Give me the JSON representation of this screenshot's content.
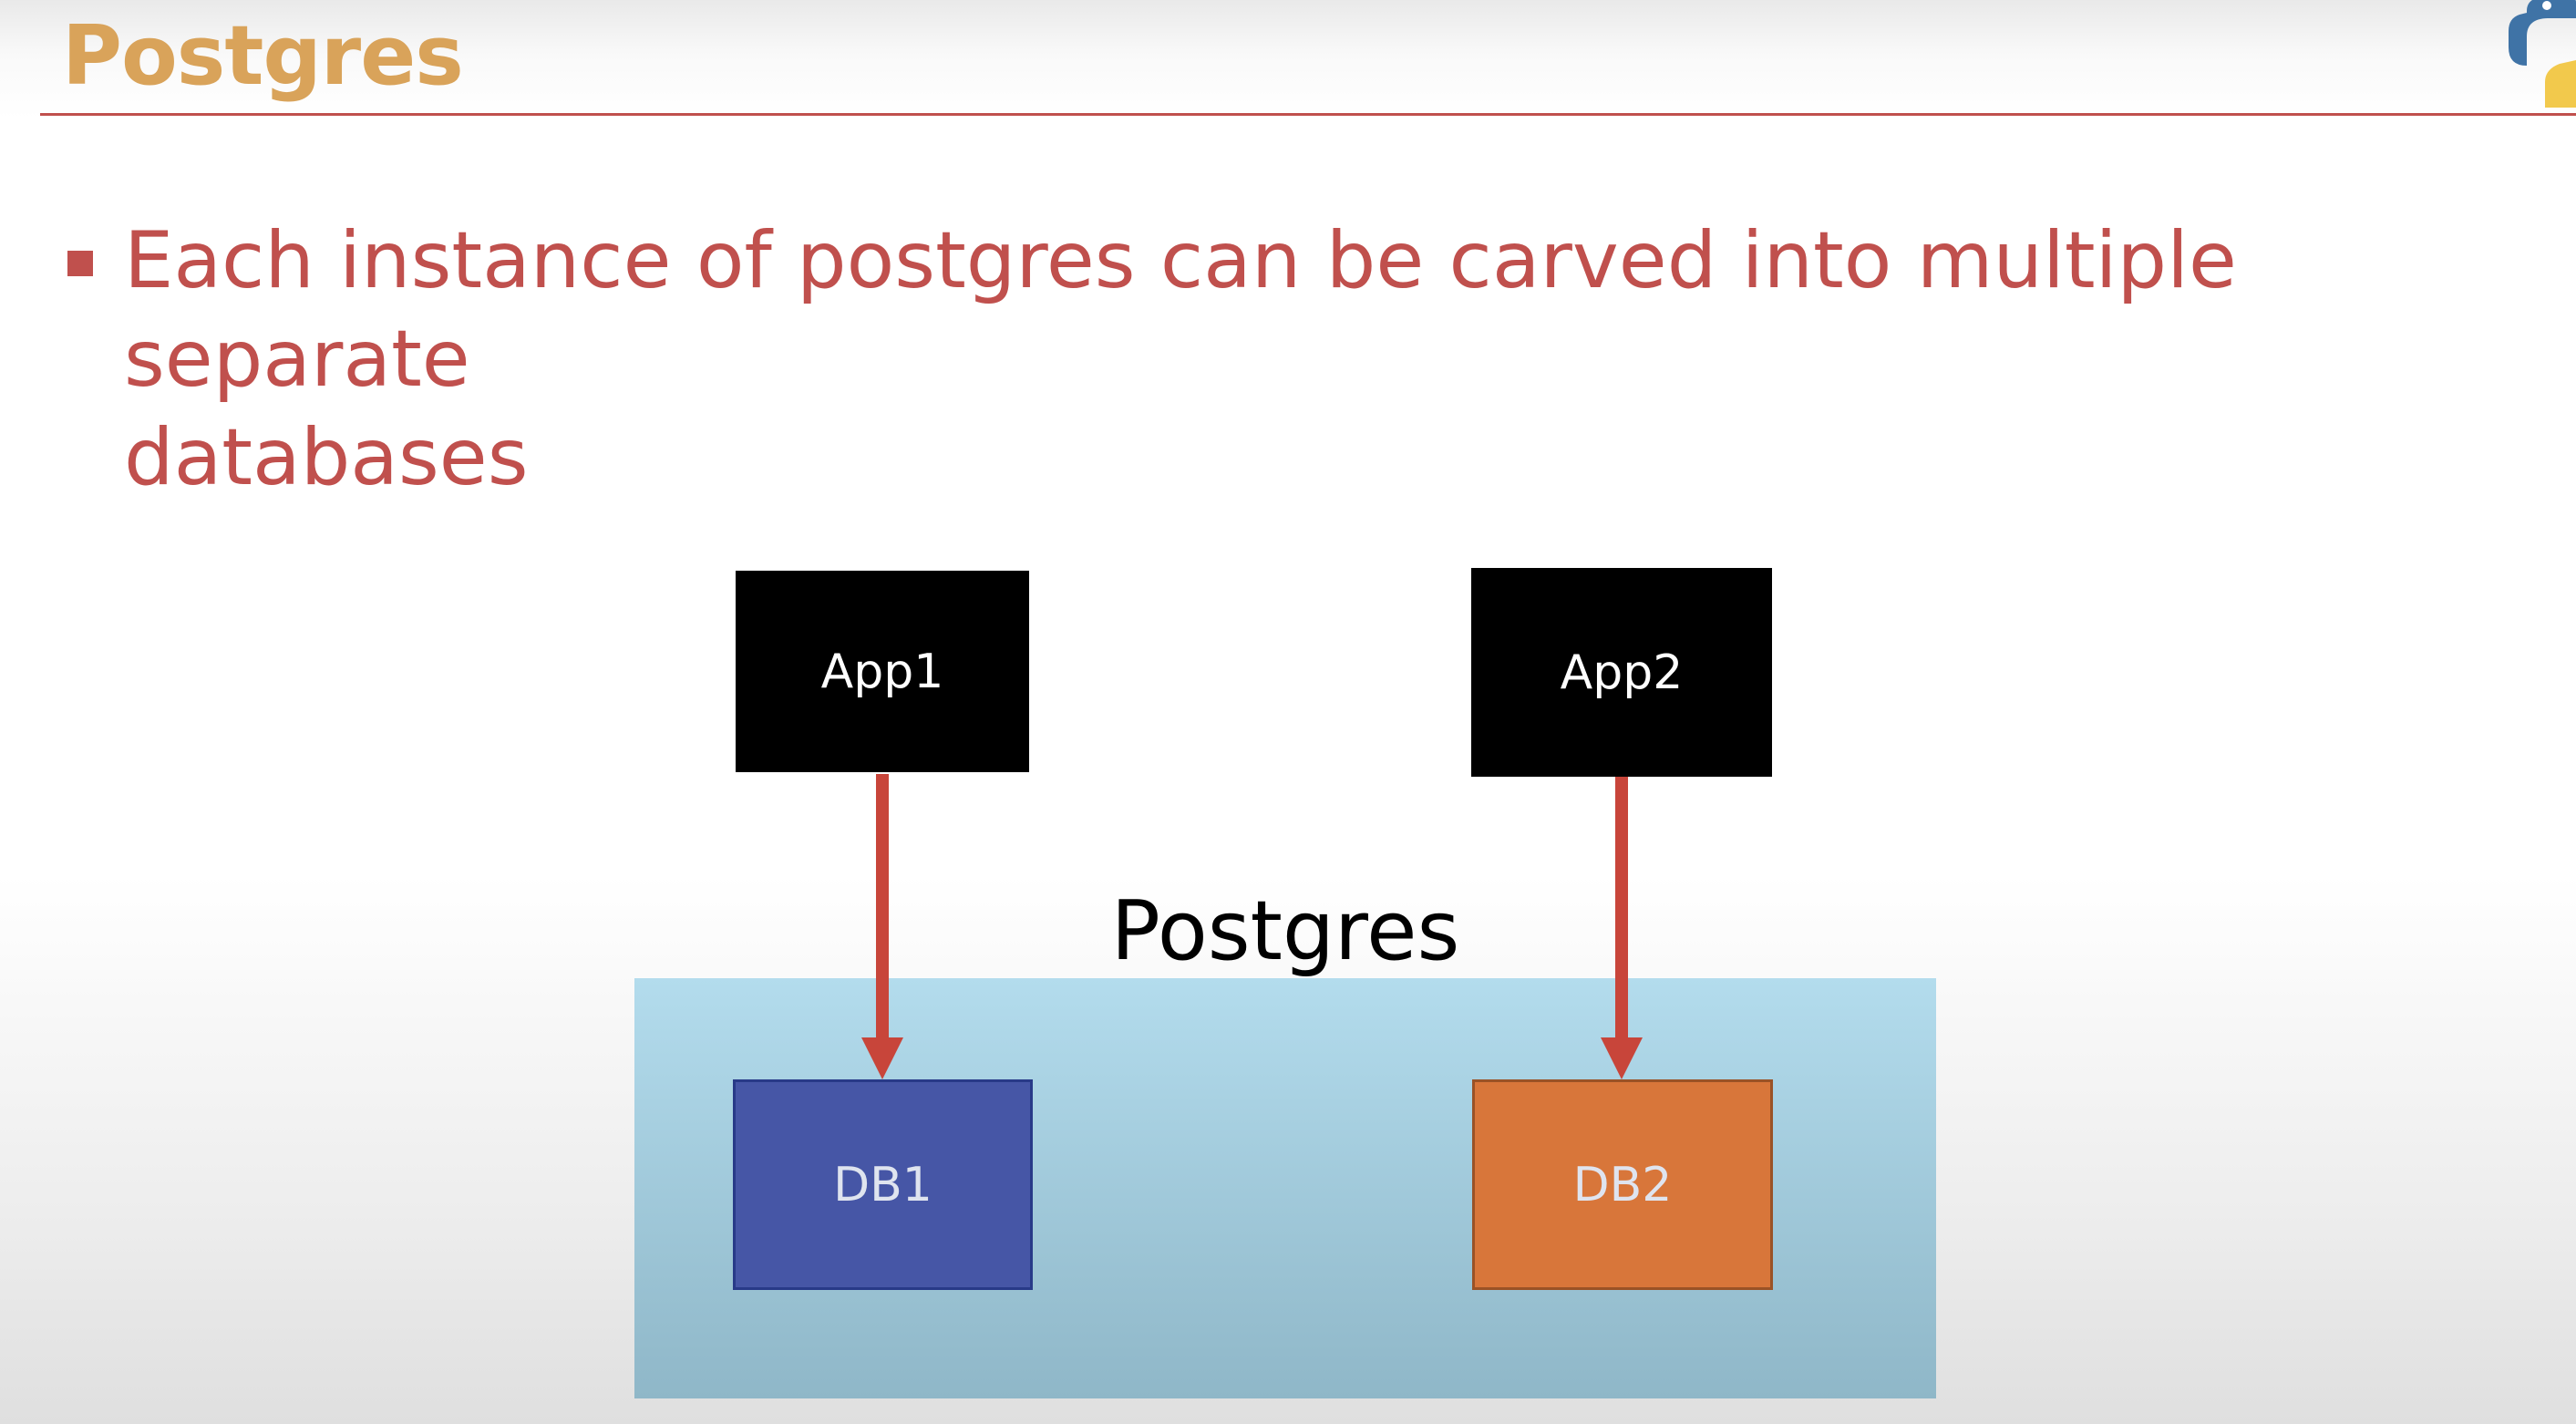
{
  "slide": {
    "title": "Postgres",
    "bullet": "Each instance of postgres can be carved into multiple separate\ndatabases"
  },
  "diagram": {
    "apps": [
      {
        "label": "App1"
      },
      {
        "label": "App2"
      }
    ],
    "container_label": "Postgres",
    "databases": [
      {
        "label": "DB1"
      },
      {
        "label": "DB2"
      }
    ],
    "connections": [
      {
        "from": "App1",
        "to": "DB1"
      },
      {
        "from": "App2",
        "to": "DB2"
      }
    ]
  },
  "icons": {
    "corner_logo": "python-logo-icon",
    "bullet": "square-bullet-icon"
  },
  "colors": {
    "title": "#d9a35a",
    "rule": "#c0504d",
    "bullet": "#c0504d",
    "bullet_text": "#c0504d",
    "app_box": "#000000",
    "app_text": "#ffffff",
    "container_top": "#b3dced",
    "container_bottom": "#8fb7c8",
    "db1_fill": "#4656a6",
    "db1_border": "#283a88",
    "db2_fill": "#d8763a",
    "db2_border": "#9a5226",
    "db_text": "#dfe4ef",
    "arrow": "#c8453a",
    "container_text": "#000000"
  }
}
